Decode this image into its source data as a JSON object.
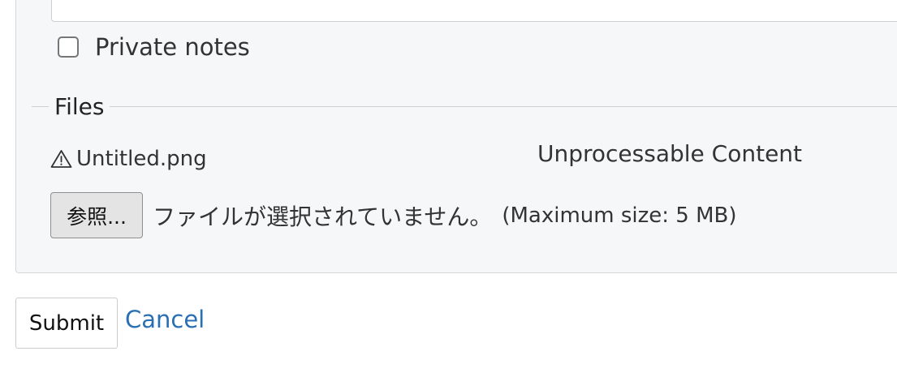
{
  "form": {
    "private_notes_label": "Private notes",
    "private_notes_checked": false
  },
  "files": {
    "legend": "Files",
    "items": [
      {
        "name": "Untitled.png",
        "status": "Unprocessable Content",
        "icon": "warning-icon"
      }
    ],
    "browse_button_label": "参照...",
    "no_file_selected": "ファイルが選択されていません。",
    "max_size": "(Maximum size: 5 MB)"
  },
  "actions": {
    "submit_label": "Submit",
    "cancel_label": "Cancel"
  },
  "colors": {
    "link": "#2a6fb3",
    "panel_background": "#f6f7f8"
  }
}
